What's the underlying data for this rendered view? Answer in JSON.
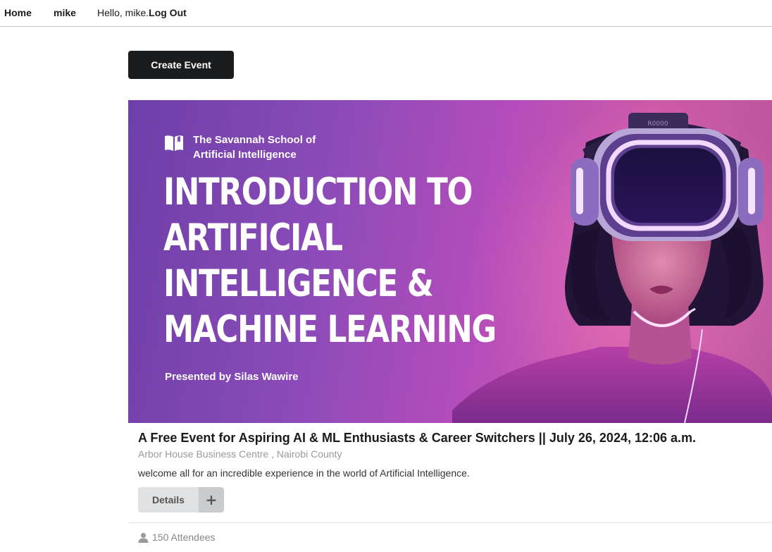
{
  "nav": {
    "home": "Home",
    "user": "mike",
    "greeting": "Hello, mike.",
    "logout": "Log Out"
  },
  "actions": {
    "create_event": "Create Event"
  },
  "event": {
    "banner": {
      "school_line1": "The Savannah School of",
      "school_line2": "Artificial Intelligence",
      "headline_line1": "INTRODUCTION TO",
      "headline_line2": "ARTIFICIAL",
      "headline_line3": "INTELLIGENCE &",
      "headline_line4": "MACHINE LEARNING",
      "presented_prefix": "Presented by ",
      "presenter": "Silas Wawire",
      "headset_label": "R0000"
    },
    "title": "A Free Event for Aspiring AI & ML Enthusiasts & Career Switchers || July 26, 2024, 12:06 a.m.",
    "location": "Arbor House Business Centre , Nairobi County",
    "description": "welcome all for an incredible experience in the world of Artificial Intelligence.",
    "details_label": "Details",
    "plus_label": "+",
    "attendees": "150 Attendees",
    "icons": {
      "book": "book-icon",
      "user": "user-icon",
      "plus": "plus-icon"
    }
  },
  "colors": {
    "create_button_bg": "#1b1c1d",
    "details_bg": "#e0e1e2",
    "banner_purple": "#8a4bb8",
    "banner_pink": "#cd5aa8",
    "headset_glow": "#f3d9ff"
  }
}
